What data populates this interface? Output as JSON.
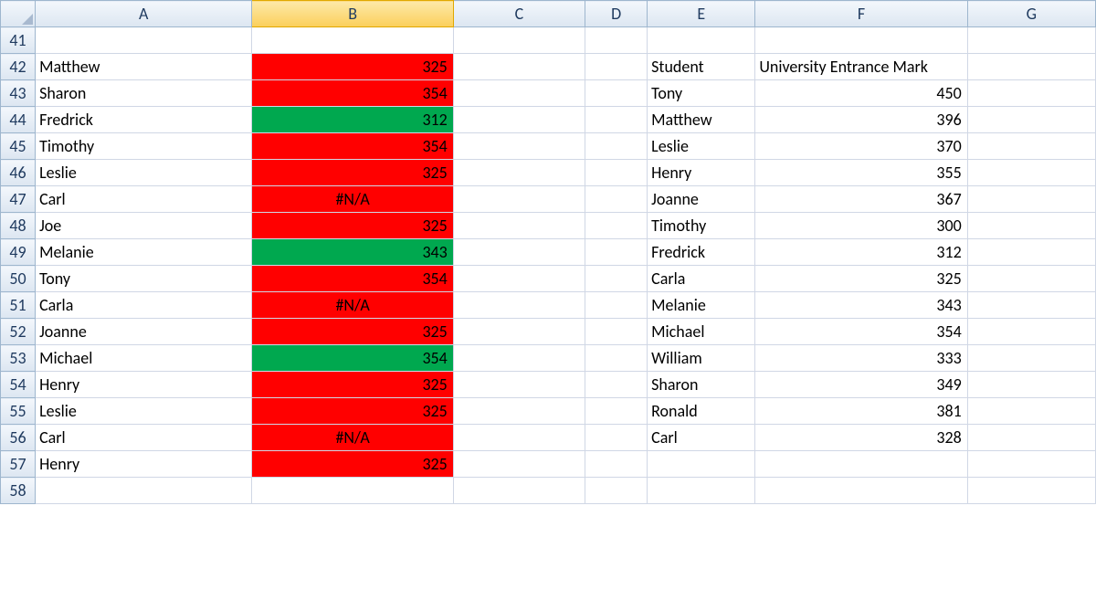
{
  "columns": [
    "A",
    "B",
    "C",
    "D",
    "E",
    "F",
    "G"
  ],
  "selectedColumn": "B",
  "rows": [
    41,
    42,
    43,
    44,
    45,
    46,
    47,
    48,
    49,
    50,
    51,
    52,
    53,
    54,
    55,
    56,
    57,
    58
  ],
  "colA": {
    "42": "Matthew",
    "43": "Sharon",
    "44": "Fredrick",
    "45": "Timothy",
    "46": "Leslie",
    "47": "Carl",
    "48": "Joe",
    "49": "Melanie",
    "50": "Tony",
    "51": "Carla",
    "52": "Joanne",
    "53": "Michael",
    "54": "Henry",
    "55": "Leslie",
    "56": "Carl",
    "57": "Henry"
  },
  "colB": {
    "42": {
      "v": "325",
      "fill": "red",
      "align": "num"
    },
    "43": {
      "v": "354",
      "fill": "red",
      "align": "num"
    },
    "44": {
      "v": "312",
      "fill": "grn",
      "align": "num"
    },
    "45": {
      "v": "354",
      "fill": "red",
      "align": "num"
    },
    "46": {
      "v": "325",
      "fill": "red",
      "align": "num"
    },
    "47": {
      "v": "#N/A",
      "fill": "red",
      "align": "ctr"
    },
    "48": {
      "v": "325",
      "fill": "red",
      "align": "num"
    },
    "49": {
      "v": "343",
      "fill": "grn",
      "align": "num"
    },
    "50": {
      "v": "354",
      "fill": "red",
      "align": "num"
    },
    "51": {
      "v": "#N/A",
      "fill": "red",
      "align": "ctr"
    },
    "52": {
      "v": "325",
      "fill": "red",
      "align": "num"
    },
    "53": {
      "v": "354",
      "fill": "grn",
      "align": "num"
    },
    "54": {
      "v": "325",
      "fill": "red",
      "align": "num"
    },
    "55": {
      "v": "325",
      "fill": "red",
      "align": "num"
    },
    "56": {
      "v": "#N/A",
      "fill": "red",
      "align": "ctr"
    },
    "57": {
      "v": "325",
      "fill": "red",
      "align": "num"
    }
  },
  "colE": {
    "42": "Student",
    "43": "Tony",
    "44": "Matthew",
    "45": "Leslie",
    "46": "Henry",
    "47": "Joanne",
    "48": "Timothy",
    "49": "Fredrick",
    "50": "Carla",
    "51": "Melanie",
    "52": "Michael",
    "53": "William",
    "54": "Sharon",
    "55": "Ronald",
    "56": "Carl"
  },
  "colF_header": "University Entrance Mark",
  "colF": {
    "43": "450",
    "44": "396",
    "45": "370",
    "46": "355",
    "47": "367",
    "48": "300",
    "49": "312",
    "50": "325",
    "51": "343",
    "52": "354",
    "53": "333",
    "54": "349",
    "55": "381",
    "56": "328"
  }
}
